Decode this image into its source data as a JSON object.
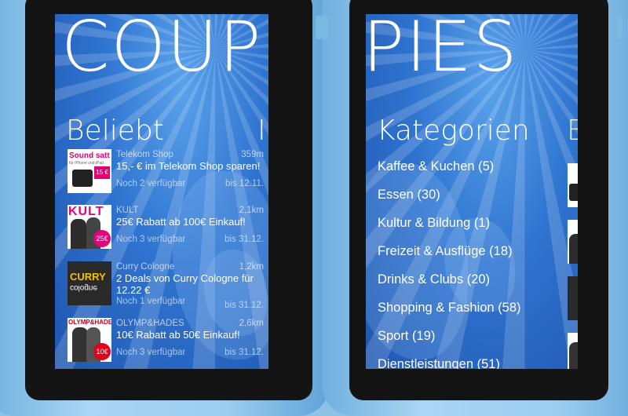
{
  "app": {
    "title_left": "COUP",
    "title_right": "PIES"
  },
  "left_screen": {
    "section_title": "Beliebt",
    "next_section_peek": "I",
    "deals": [
      {
        "store": "Telekom Shop",
        "distance": "359m",
        "title": "15,- € im Telekom Shop sparen!",
        "availability": "Noch 2 verfügbar",
        "until": "bis 12.11.",
        "thumb": {
          "headline": "Sound satt",
          "subline": "für iPhone und iPad",
          "price": "15 €"
        }
      },
      {
        "store": "KULT",
        "distance": "2,1km",
        "title": "25€ Rabatt ab 100€ Einkauf!",
        "availability": "Noch 3 verfügbar",
        "until": "bis 31.12.",
        "thumb": {
          "headline": "KULT",
          "badge": "25€"
        }
      },
      {
        "store": "Curry Cologne",
        "distance": "1,2km",
        "title": "2 Deals von Curry Cologne für 12.22 €",
        "availability": "Noch 1 verfügbar",
        "until": "bis 31.12.",
        "thumb": {
          "headline": "CURRY",
          "subline": "cologne"
        }
      },
      {
        "store": "OLYMP&HADES",
        "distance": "2,6km",
        "title": "10€ Rabatt ab 50€ Einkauf!",
        "availability": "Noch 3 verfügbar",
        "until": "bis 31.12.",
        "thumb": {
          "headline": "OLYMP&HADES",
          "badge": "10€"
        }
      }
    ]
  },
  "right_screen": {
    "section_title": "Kategorien",
    "next_section_peek": "B",
    "categories": [
      "Kaffee & Kuchen (5)",
      "Essen (30)",
      "Kultur & Bildung (1)",
      "Freizeit & Ausflüge (18)",
      "Drinks & Clubs (20)",
      "Shopping & Fashion (58)",
      "Sport (19)",
      "Dienstleistungen (51)"
    ]
  },
  "colors": {
    "screen_blue": "#2f74d0",
    "phone_cyan": "#8fc3e6",
    "text": "#ffffff"
  }
}
